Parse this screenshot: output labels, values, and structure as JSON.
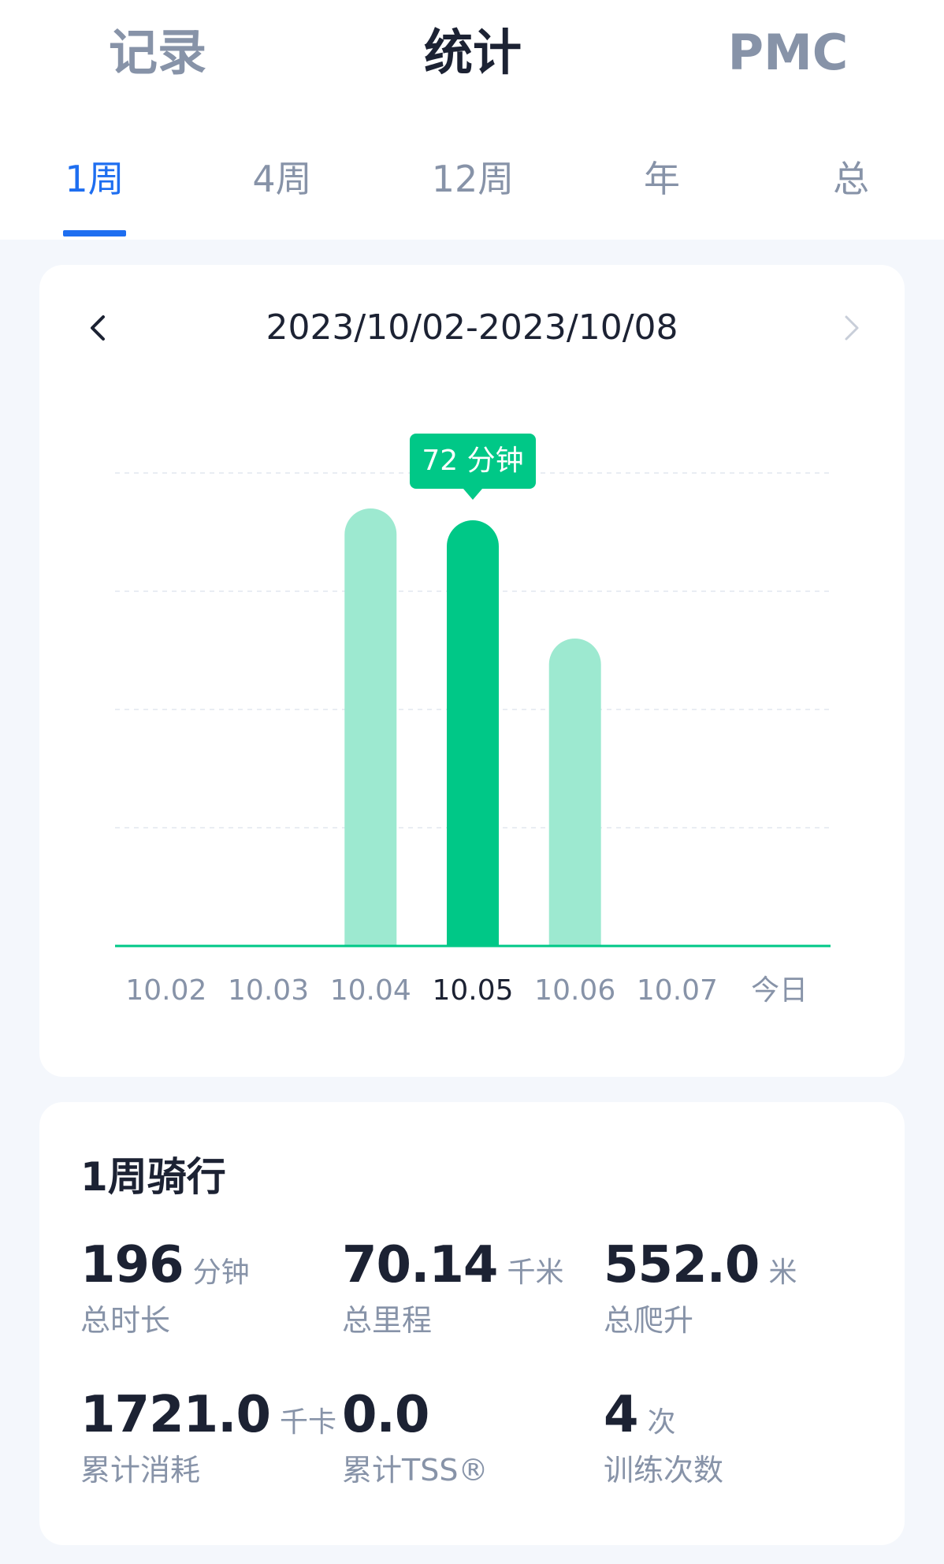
{
  "main_tabs": [
    {
      "label": "记录",
      "active": false
    },
    {
      "label": "统计",
      "active": true
    },
    {
      "label": "PMC",
      "active": false
    }
  ],
  "sub_tabs": [
    {
      "label": "1周",
      "active": true
    },
    {
      "label": "4周",
      "active": false
    },
    {
      "label": "12周",
      "active": false
    },
    {
      "label": "年",
      "active": false
    },
    {
      "label": "总",
      "active": false
    }
  ],
  "date_nav": {
    "range": "2023/10/02-2023/10/08",
    "prev_icon": "chevron-left-icon",
    "next_icon": "chevron-right-icon"
  },
  "chart_data": {
    "type": "bar",
    "categories": [
      "10.02",
      "10.03",
      "10.04",
      "10.05",
      "10.06",
      "10.07",
      "今日"
    ],
    "values": [
      0,
      0,
      74,
      72,
      52,
      0,
      0
    ],
    "unit": "分钟",
    "ylim": [
      0,
      80
    ],
    "grid": true,
    "selected_index": 3,
    "tooltip": "72 分钟",
    "colors": {
      "bar": "#9de9d0",
      "selected": "#00c887",
      "axis": "#00c887",
      "grid": "#e9edf3"
    }
  },
  "summary": {
    "title": "1周骑行",
    "stats": [
      {
        "value": "196",
        "unit": "分钟",
        "label": "总时长"
      },
      {
        "value": "70.14",
        "unit": "千米",
        "label": "总里程"
      },
      {
        "value": "552.0",
        "unit": "米",
        "label": "总爬升"
      },
      {
        "value": "1721.0",
        "unit": "千卡",
        "label": "累计消耗"
      },
      {
        "value": "0.0",
        "unit": "",
        "label": "累计TSS®"
      },
      {
        "value": "4",
        "unit": "次",
        "label": "训练次数"
      }
    ]
  },
  "colors": {
    "accent": "#1e6ef0",
    "text": "#1c2233",
    "muted": "#8793a8",
    "background": "#f4f7fc"
  }
}
